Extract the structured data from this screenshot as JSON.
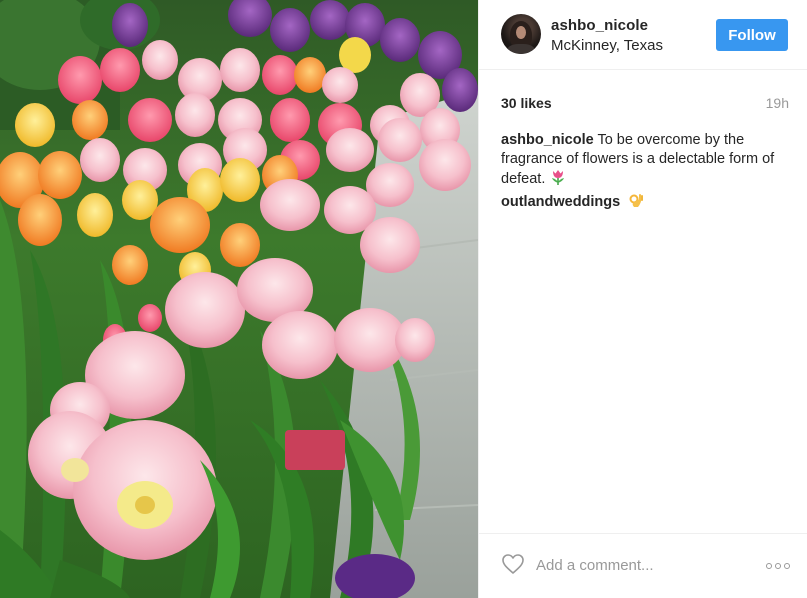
{
  "post": {
    "username": "ashbo_nicole",
    "location": "McKinney, Texas",
    "follow_label": "Follow",
    "likes": "30 likes",
    "time_ago": "19h",
    "caption": {
      "author": "ashbo_nicole",
      "text": "To be overcome by the fragrance of flowers is a delectable form of defeat."
    },
    "comments": [
      {
        "author": "outlandweddings"
      }
    ],
    "comment_placeholder": "Add a comment..."
  },
  "icons": {
    "heart": "heart-outline-icon",
    "more": "more-options-icon",
    "caption_emoji": "tulip-emoji",
    "comment_emoji": "ok-hand-emoji"
  },
  "colors": {
    "follow_button": "#3897f0",
    "text": "#262626",
    "muted": "#999999",
    "border": "#efefef"
  }
}
